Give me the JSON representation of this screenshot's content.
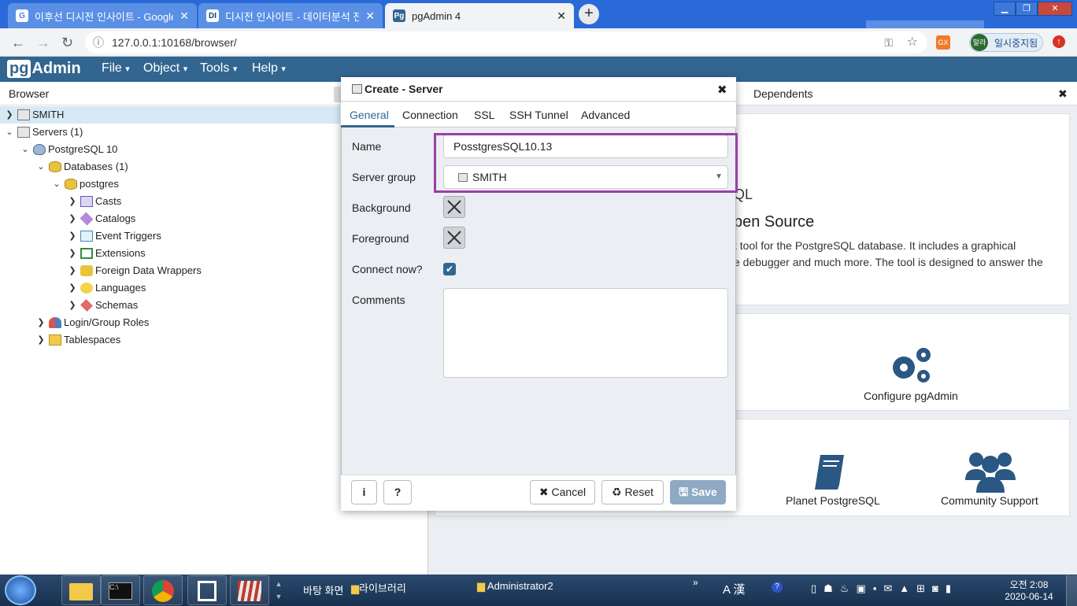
{
  "chrome": {
    "tabs": [
      {
        "title": "이후선 디시전 인사이트 - Google",
        "favicon": "G"
      },
      {
        "title": "디시전 인사이트 - 데이터분석 전",
        "favicon": "DI"
      },
      {
        "title": "pgAdmin 4",
        "favicon": "Pg"
      }
    ],
    "url": "127.0.0.1:10168/browser/",
    "profile_label": "말라",
    "pause_label": "일시중지됨"
  },
  "app": {
    "logo_pg": "pg",
    "logo_rest": "Admin",
    "menu": [
      "File",
      "Object",
      "Tools",
      "Help"
    ]
  },
  "browser": {
    "title": "Browser",
    "tree": [
      {
        "label": "SMITH",
        "icon": "server-group-icon"
      },
      {
        "label": "Servers (1)",
        "icon": "server-group-icon"
      },
      {
        "label": "PostgreSQL 10",
        "icon": "elephant-icon"
      },
      {
        "label": "Databases (1)",
        "icon": "database-icon"
      },
      {
        "label": "postgres",
        "icon": "database-icon"
      },
      {
        "label": "Casts",
        "icon": "cast-icon"
      },
      {
        "label": "Catalogs",
        "icon": "catalog-icon"
      },
      {
        "label": "Event Triggers",
        "icon": "trigger-icon"
      },
      {
        "label": "Extensions",
        "icon": "extension-icon"
      },
      {
        "label": "Foreign Data Wrappers",
        "icon": "fdw-icon"
      },
      {
        "label": "Languages",
        "icon": "language-icon"
      },
      {
        "label": "Schemas",
        "icon": "schema-icon"
      },
      {
        "label": "Login/Group Roles",
        "icon": "roles-icon"
      },
      {
        "label": "Tablespaces",
        "icon": "tablespace-icon"
      }
    ]
  },
  "main": {
    "tab_partial": "s",
    "tab_dependents": "Dependents",
    "welcome_partial": "QL",
    "heading_partial": "pen Source",
    "desc_line1": "t tool for the PostgreSQL database. It includes a graphical",
    "desc_line2": "e debugger and much more. The tool is designed to answer the",
    "configure_label": "Configure pgAdmin",
    "planet_label": "Planet PostgreSQL",
    "community_label": "Community Support"
  },
  "dialog": {
    "title": "Create - Server",
    "tabs": [
      "General",
      "Connection",
      "SSL",
      "SSH Tunnel",
      "Advanced"
    ],
    "labels": {
      "name": "Name",
      "server_group": "Server group",
      "background": "Background",
      "foreground": "Foreground",
      "connect_now": "Connect now?",
      "comments": "Comments"
    },
    "name_value": "PosstgresSQL10.13",
    "server_group_value": "SMITH",
    "connect_now": true,
    "buttons": {
      "info": "i",
      "help": "?",
      "cancel": "Cancel",
      "reset": "Reset",
      "save": "Save"
    },
    "highlight_color": "#9b3fa6"
  },
  "taskbar": {
    "desktop_label": "바탕 화면",
    "library_label": "라이브러리",
    "folder_label": "Administrator2",
    "time": "오전 2:08",
    "date": "2020-06-14",
    "ime": "A 漢"
  }
}
